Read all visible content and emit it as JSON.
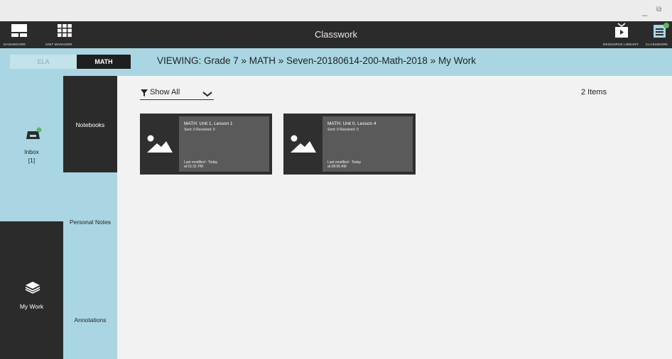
{
  "window": {
    "minimize_glyph": "_",
    "restore_glyph": "⧉"
  },
  "topbar": {
    "title": "Classwork",
    "dashboard_label": "DASHBOARD",
    "unit_manager_label": "UNIT MANAGER",
    "resource_library_label": "RESOURCE LIBRARY",
    "classwork_label": "CLASSWORK",
    "notification_color": "#5cb85c"
  },
  "subjects": {
    "ela_label": "ELA",
    "math_label": "MATH"
  },
  "breadcrumb": "VIEWING: Grade  7 » MATH » Seven-20180614-200-Math-2018  » My Work",
  "nav": {
    "inbox_label": "Inbox",
    "inbox_count": "[1]",
    "mywork_label": "My Work",
    "notebooks_label": "Notebooks",
    "personal_notes_label": "Personal Notes",
    "annotations_label": "Annotations"
  },
  "main": {
    "filter_label": "Show All",
    "items_count": "2 Items",
    "cards": [
      {
        "title": "MATH: Unit 1, Lesson 1",
        "sent": "Sent: 0 Received: 0",
        "modified_line1": "Last modified : Today",
        "modified_line2": " at 01:31 PM"
      },
      {
        "title": "MATH: Unit 0, Lesson 4",
        "sent": "Sent: 0 Received: 0",
        "modified_line1": "Last modified : Today",
        "modified_line2": " at 08:56 AM"
      }
    ]
  },
  "colors": {
    "light_blue": "#a9d6e2",
    "dark": "#2b2b2b"
  }
}
